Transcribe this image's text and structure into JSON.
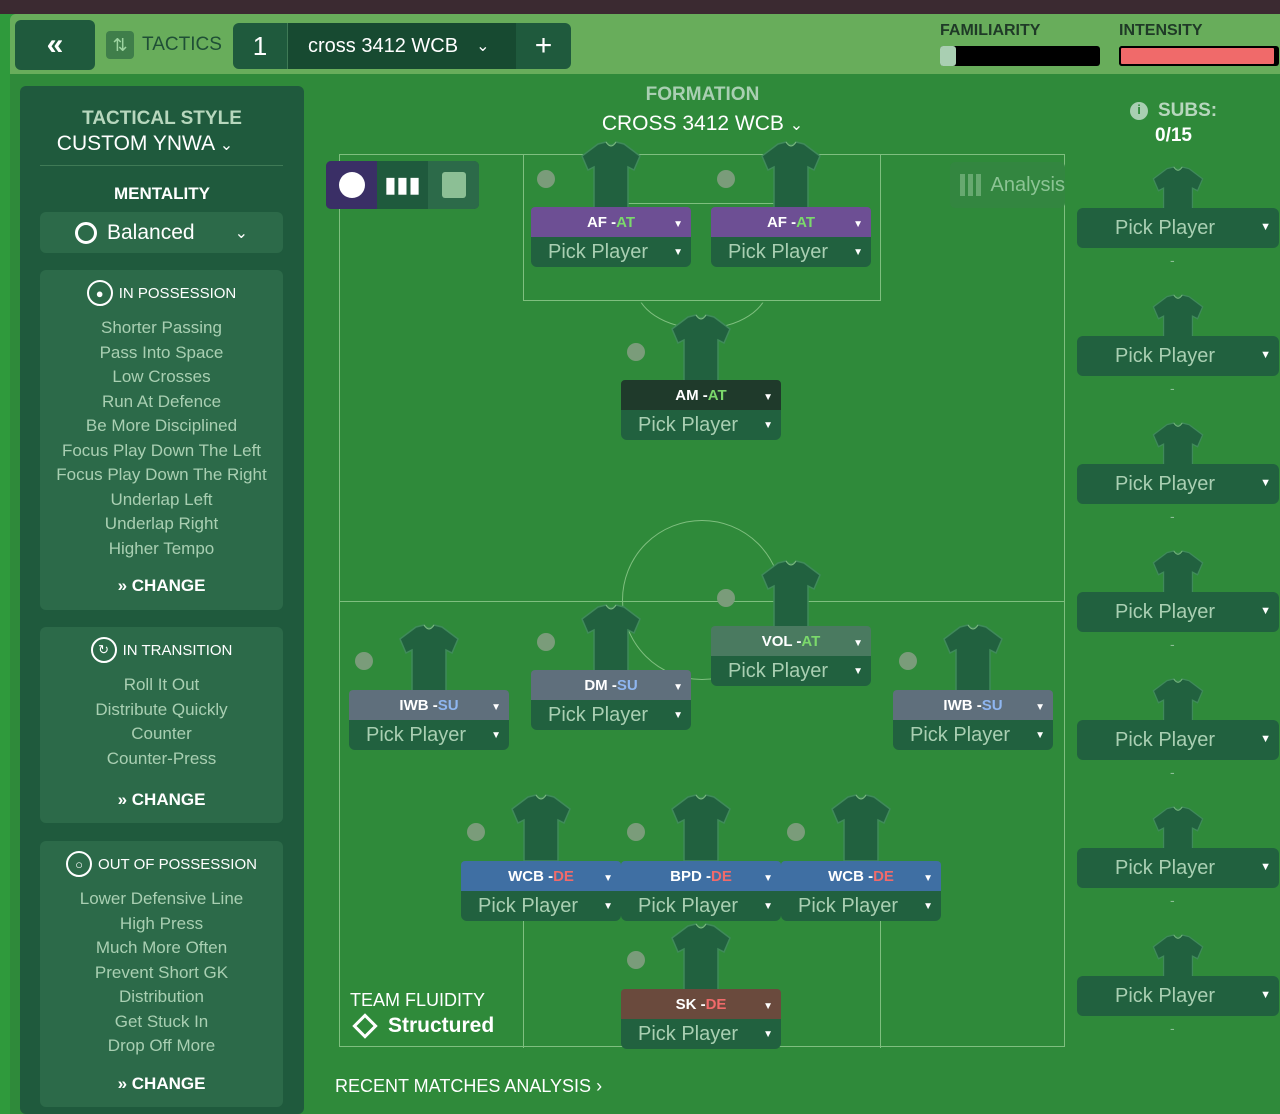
{
  "topbar": {
    "back_glyph": "«",
    "tactics_label": "TACTICS",
    "slot_number": "1",
    "tactic_name": "cross 3412 WCB",
    "add_glyph": "+",
    "familiarity_label": "FAMILIARITY",
    "intensity_label": "INTENSITY",
    "familiarity_value": 0.1,
    "intensity_value": 0.98
  },
  "sidebar": {
    "style_heading": "TACTICAL STYLE",
    "style_value": "CUSTOM YNWA",
    "mentality_heading": "MENTALITY",
    "mentality_value": "Balanced",
    "in_possession": {
      "title": "IN POSSESSION",
      "items": [
        "Shorter Passing",
        "Pass Into Space",
        "Low Crosses",
        "Run At Defence",
        "Be More Disciplined",
        "Focus Play Down The Left",
        "Focus Play Down The Right",
        "Underlap Left",
        "Underlap Right",
        "Higher Tempo"
      ],
      "change": "CHANGE"
    },
    "in_transition": {
      "title": "IN TRANSITION",
      "items": [
        "Roll It Out",
        "Distribute Quickly",
        "Counter",
        "Counter-Press"
      ],
      "change": "CHANGE"
    },
    "out_of_possession": {
      "title": "OUT OF POSSESSION",
      "items": [
        "Lower Defensive Line",
        "High Press",
        "Much More Often",
        "Prevent Short GK",
        "Distribution",
        "Get Stuck In",
        "Drop Off More"
      ],
      "change": "CHANGE"
    }
  },
  "formation": {
    "heading": "FORMATION",
    "name": "CROSS 3412 WCB",
    "analysis": "Analysis"
  },
  "positions": [
    {
      "role": "AF",
      "duty": "AT",
      "pick": "Pick Player",
      "color": "#6d4f94"
    },
    {
      "role": "AF",
      "duty": "AT",
      "pick": "Pick Player",
      "color": "#6d4f94"
    },
    {
      "role": "AM",
      "duty": "AT",
      "pick": "Pick Player",
      "color": "#1f3a2b"
    },
    {
      "role": "VOL",
      "duty": "AT",
      "pick": "Pick Player",
      "color": "#4a7a60"
    },
    {
      "role": "IWB",
      "duty": "SU",
      "pick": "Pick Player",
      "color": "#5f6f7c"
    },
    {
      "role": "DM",
      "duty": "SU",
      "pick": "Pick Player",
      "color": "#5f6f7c"
    },
    {
      "role": "IWB",
      "duty": "SU",
      "pick": "Pick Player",
      "color": "#5f6f7c"
    },
    {
      "role": "WCB",
      "duty": "DE",
      "pick": "Pick Player",
      "color": "#3f6fa3"
    },
    {
      "role": "BPD",
      "duty": "DE",
      "pick": "Pick Player",
      "color": "#3f6fa3"
    },
    {
      "role": "WCB",
      "duty": "DE",
      "pick": "Pick Player",
      "color": "#3f6fa3"
    },
    {
      "role": "SK",
      "duty": "DE",
      "pick": "Pick Player",
      "color": "#6a4a3d"
    }
  ],
  "duty_colors": {
    "AT": "#7bd96b",
    "SU": "#8fb6f0",
    "DE": "#f06a6a"
  },
  "fluidity": {
    "heading": "TEAM FLUIDITY",
    "value": "Structured"
  },
  "recent": "RECENT MATCHES ANALYSIS",
  "subs": {
    "heading": "SUBS:",
    "count": "0/15",
    "slots": [
      "Pick Player",
      "Pick Player",
      "Pick Player",
      "Pick Player",
      "Pick Player",
      "Pick Player",
      "Pick Player"
    ],
    "dash": "-"
  }
}
